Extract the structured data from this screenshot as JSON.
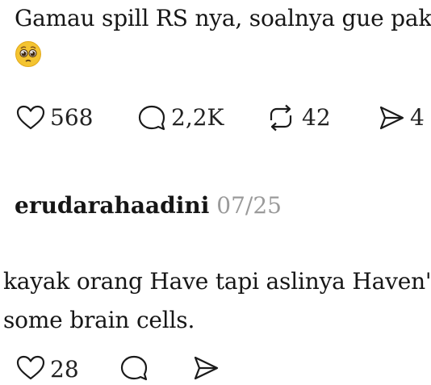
{
  "post1": {
    "text": "Gamau spill RS nya, soalnya gue pak",
    "emoji": "pleading-face-emoji",
    "actions": {
      "like_count": "568",
      "reply_count": "2,2K",
      "repost_count": "42",
      "share_count": "4"
    }
  },
  "post2": {
    "username": "erudarahaadini",
    "date": "07/25",
    "line1": "kayak orang Have tapi aslinya Haven't",
    "line2": "some brain cells.",
    "actions": {
      "like_count": "28"
    }
  },
  "colors": {
    "text": "#161616",
    "muted": "#9a9a9a",
    "emoji_face": "#f4c430",
    "background": "#ffffff"
  }
}
